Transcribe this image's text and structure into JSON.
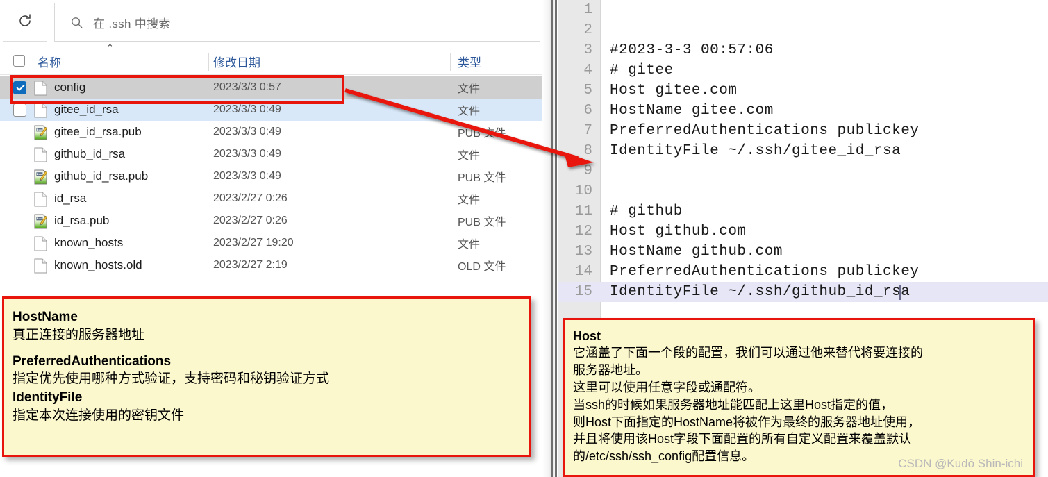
{
  "explorer": {
    "toolbar": {
      "refresh_icon": "refresh-icon",
      "search_icon": "search-icon",
      "search_placeholder": "在 .ssh 中搜索",
      "search_value": ""
    },
    "columns": {
      "name": "名称",
      "date_modified": "修改日期",
      "type": "类型",
      "sort_caret": "⌃"
    },
    "files": [
      {
        "name": "config",
        "date": "2023/3/3 0:57",
        "type": "文件",
        "icon": "file-icon",
        "checked": true,
        "selected": true,
        "hovered": false
      },
      {
        "name": "gitee_id_rsa",
        "date": "2023/3/3 0:49",
        "type": "文件",
        "icon": "file-icon",
        "checked": false,
        "selected": false,
        "hovered": true
      },
      {
        "name": "gitee_id_rsa.pub",
        "date": "2023/3/3 0:49",
        "type": "PUB 文件",
        "icon": "pub-file-icon",
        "checked": false,
        "selected": false,
        "hovered": false
      },
      {
        "name": "github_id_rsa",
        "date": "2023/3/3 0:49",
        "type": "文件",
        "icon": "file-icon",
        "checked": false,
        "selected": false,
        "hovered": false
      },
      {
        "name": "github_id_rsa.pub",
        "date": "2023/3/3 0:49",
        "type": "PUB 文件",
        "icon": "pub-file-icon",
        "checked": false,
        "selected": false,
        "hovered": false
      },
      {
        "name": "id_rsa",
        "date": "2023/2/27 0:26",
        "type": "文件",
        "icon": "file-icon",
        "checked": false,
        "selected": false,
        "hovered": false
      },
      {
        "name": "id_rsa.pub",
        "date": "2023/2/27 0:26",
        "type": "PUB 文件",
        "icon": "pub-file-icon",
        "checked": false,
        "selected": false,
        "hovered": false
      },
      {
        "name": "known_hosts",
        "date": "2023/2/27 19:20",
        "type": "文件",
        "icon": "file-icon",
        "checked": false,
        "selected": false,
        "hovered": false
      },
      {
        "name": "known_hosts.old",
        "date": "2023/2/27 2:19",
        "type": "OLD 文件",
        "icon": "file-icon",
        "checked": false,
        "selected": false,
        "hovered": false
      }
    ]
  },
  "editor": {
    "lines": [
      {
        "no": "1",
        "text": "",
        "active": false
      },
      {
        "no": "2",
        "text": "",
        "active": false
      },
      {
        "no": "3",
        "text": "#2023-3-3 00:57:06",
        "active": false
      },
      {
        "no": "4",
        "text": "# gitee",
        "active": false
      },
      {
        "no": "5",
        "text": "Host gitee.com",
        "active": false
      },
      {
        "no": "6",
        "text": "HostName gitee.com",
        "active": false
      },
      {
        "no": "7",
        "text": "PreferredAuthentications publickey",
        "active": false
      },
      {
        "no": "8",
        "text": "IdentityFile ~/.ssh/gitee_id_rsa",
        "active": false
      },
      {
        "no": "9",
        "text": "",
        "active": false
      },
      {
        "no": "10",
        "text": "",
        "active": false
      },
      {
        "no": "11",
        "text": "# github",
        "active": false
      },
      {
        "no": "12",
        "text": "Host github.com",
        "active": false
      },
      {
        "no": "13",
        "text": "HostName github.com",
        "active": false
      },
      {
        "no": "14",
        "text": "PreferredAuthentications publickey",
        "active": false
      },
      {
        "no": "15",
        "text": "IdentityFile ~/.ssh/github_id_rsa",
        "active": true
      }
    ]
  },
  "notes": {
    "left": {
      "title1": "HostName",
      "desc1": "真正连接的服务器地址",
      "title2": "PreferredAuthentications",
      "desc2": "指定优先使用哪种方式验证，支持密码和秘钥验证方式",
      "title3": "IdentityFile",
      "desc3": "指定本次连接使用的密钥文件"
    },
    "right": {
      "title": "Host",
      "line1": "它涵盖了下面一个段的配置，我们可以通过他来替代将要连接的",
      "line2": "服务器地址。",
      "line3": "这里可以使用任意字段或通配符。",
      "line4": "当ssh的时候如果服务器地址能匹配上这里Host指定的值，",
      "line5": "则Host下面指定的HostName将被作为最终的服务器地址使用，",
      "line6": "并且将使用该Host字段下面配置的所有自定义配置来覆盖默认",
      "line7": "的/etc/ssh/ssh_config配置信息。",
      "watermark": "CSDN @Kudō Shin-ichi"
    }
  },
  "colors": {
    "accent_blue": "#0f6cbd",
    "header_text": "#2b579a",
    "annotation_border": "#e8150c",
    "annotation_bg": "#fcf8cd",
    "selected_row": "#cfcfcf",
    "hover_row": "#d8e8f8",
    "gutter": "#e8e8e8",
    "active_line": "#e6e6f7"
  }
}
